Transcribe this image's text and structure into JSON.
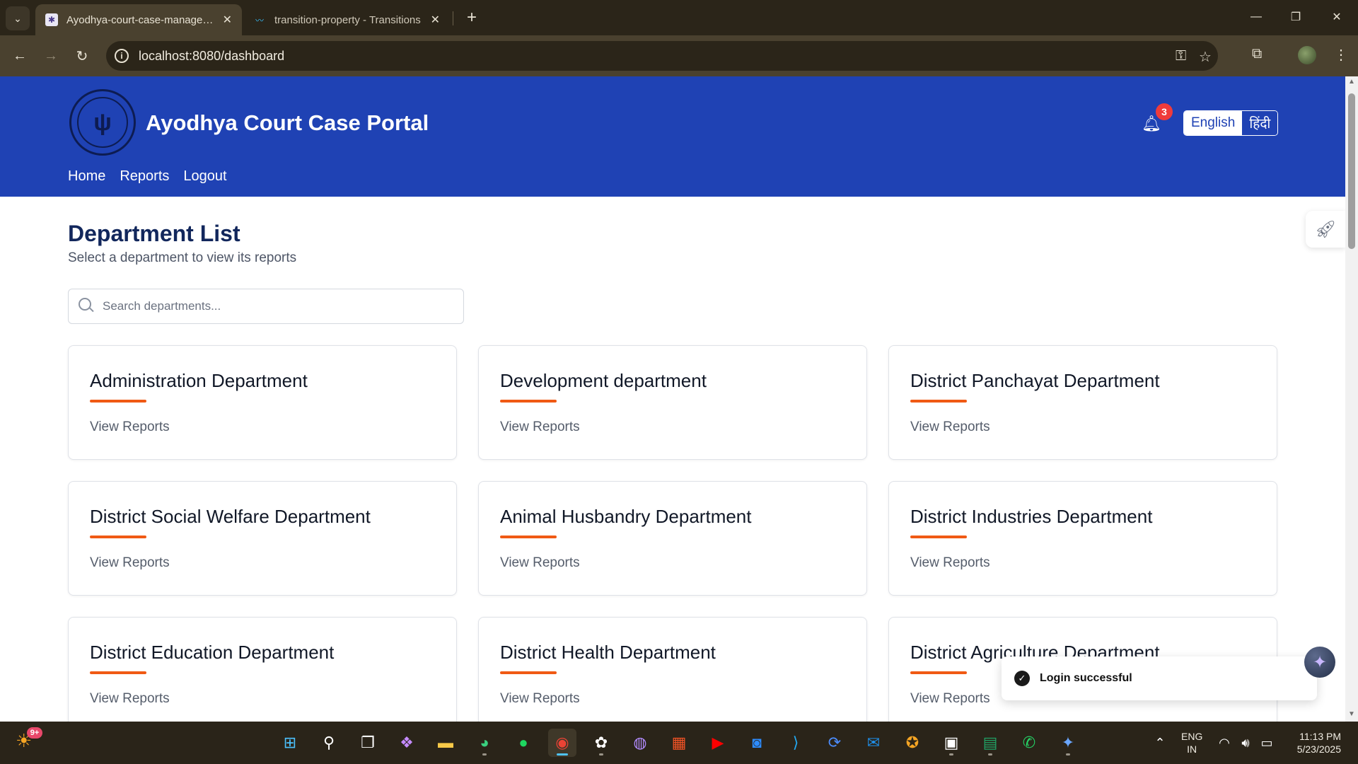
{
  "browser": {
    "tabs": [
      {
        "title": "Ayodhya-court-case-management",
        "active": true
      },
      {
        "title": "transition-property - Transitions",
        "active": false
      }
    ],
    "new_tab": "+",
    "url": "localhost:8080/dashboard",
    "window_controls": {
      "minimize": "—",
      "maximize": "❐",
      "close": "✕"
    }
  },
  "header": {
    "portal_title": "Ayodhya Court Case Portal",
    "nav": [
      {
        "label": "Home"
      },
      {
        "label": "Reports"
      },
      {
        "label": "Logout"
      }
    ],
    "notification_count": "3",
    "languages": {
      "english": "English",
      "hindi": "हिंदी"
    }
  },
  "main": {
    "title": "Department List",
    "subtitle": "Select a department to view its reports",
    "search": {
      "placeholder": "Search departments...",
      "value": ""
    },
    "departments": [
      {
        "name": "Administration Department",
        "link": "View Reports"
      },
      {
        "name": "Development department",
        "link": "View Reports"
      },
      {
        "name": "District Panchayat Department",
        "link": "View Reports"
      },
      {
        "name": "District Social Welfare Department",
        "link": "View Reports"
      },
      {
        "name": "Animal Husbandry Department",
        "link": "View Reports"
      },
      {
        "name": "District Industries Department",
        "link": "View Reports"
      },
      {
        "name": "District Education Department",
        "link": "View Reports"
      },
      {
        "name": "District Health Department",
        "link": "View Reports"
      },
      {
        "name": "District Agriculture Department",
        "link": "View Reports"
      }
    ]
  },
  "toast": {
    "message": "Login successful"
  },
  "taskbar": {
    "weather_badge": "9+",
    "language": {
      "line1": "ENG",
      "line2": "IN"
    },
    "clock": {
      "time": "11:13 PM",
      "date": "5/23/2025"
    }
  },
  "colors": {
    "header_bg": "#1f42b4",
    "accent_bar": "#f05a14",
    "title_text": "#12275c",
    "badge": "#ef3b3b"
  }
}
